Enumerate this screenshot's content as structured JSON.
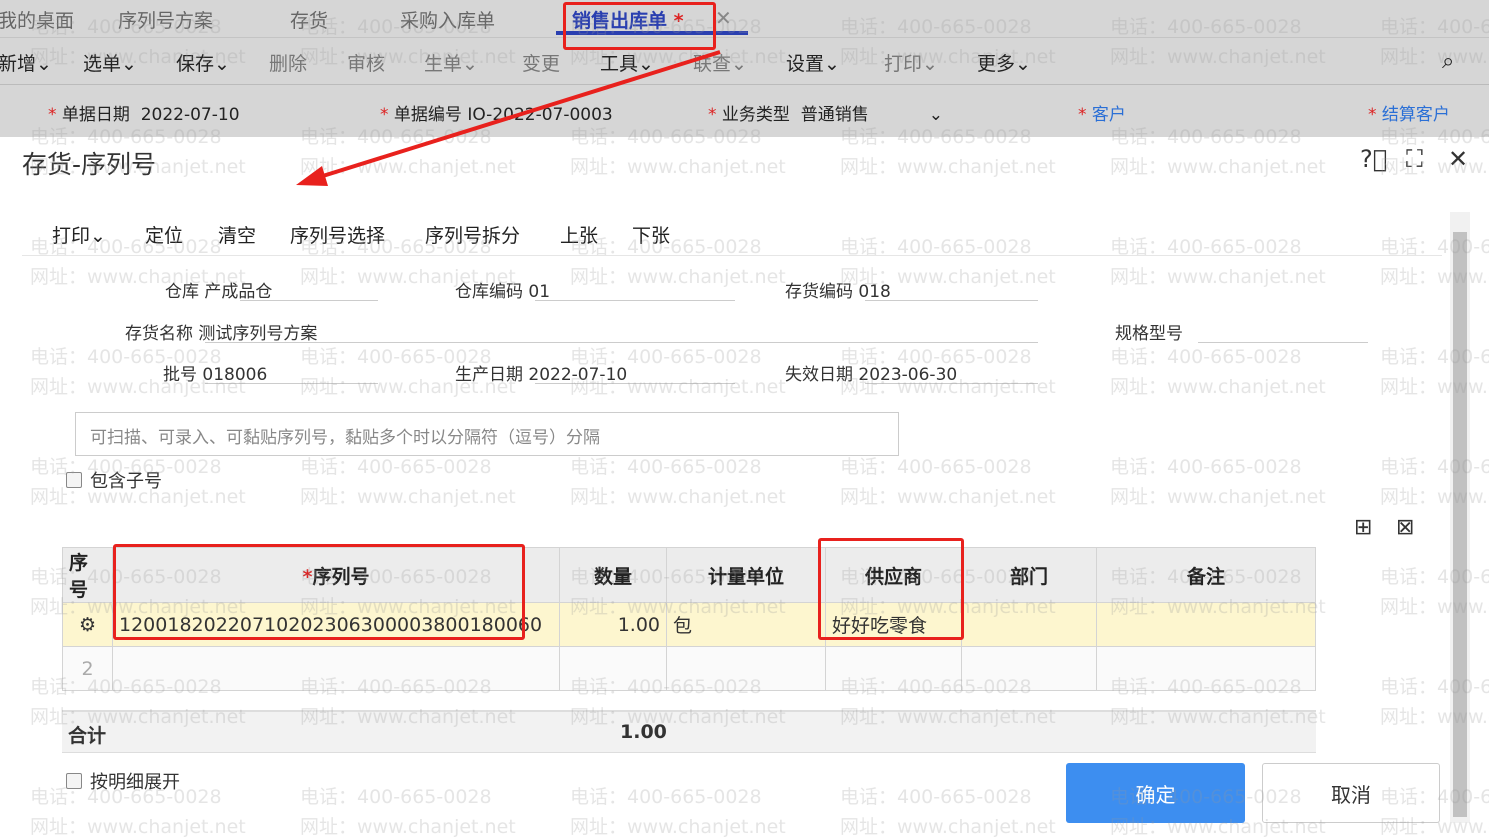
{
  "tabs": [
    "我的桌面",
    "序列号方案",
    "存货",
    "采购入库单",
    "销售出库单"
  ],
  "active_tab_star": "*",
  "toolbar": [
    "新增",
    "选单",
    "保存",
    "删除",
    "审核",
    "生单",
    "变更",
    "工具",
    "联查",
    "设置",
    "打印",
    "更多"
  ],
  "form": {
    "date_label": "单据日期",
    "date": "2022-07-10",
    "no_label": "单据编号",
    "no": "IO-2022-07-0003",
    "type_label": "业务类型",
    "type": "普通销售",
    "customer": "客户",
    "settle_customer": "结算客户"
  },
  "modal": {
    "title": "存货-序列号",
    "toolbar": [
      "打印",
      "定位",
      "清空",
      "序列号选择",
      "序列号拆分",
      "上张",
      "下张"
    ],
    "warehouse_label": "仓库",
    "warehouse": "产成品仓",
    "warehouse_code_label": "仓库编码",
    "warehouse_code": "01",
    "item_code_label": "存货编码",
    "item_code": "018",
    "item_name_label": "存货名称",
    "item_name": "测试序列号方案",
    "spec_label": "规格型号",
    "batch_label": "批号",
    "batch": "018006",
    "prod_date_label": "生产日期",
    "prod_date": "2022-07-10",
    "exp_date_label": "失效日期",
    "exp_date": "2023-06-30",
    "input_placeholder": "可扫描、可录入、可黏贴序列号，黏贴多个时以分隔符（逗号）分隔",
    "include_sub": "包含子号",
    "columns": [
      "序号",
      "序列号",
      "数量",
      "计量单位",
      "供应商",
      "部门",
      "备注"
    ],
    "rows": [
      {
        "serial": "120018202207102023063000038001800 60",
        "qty": "1.00",
        "unit": "包",
        "supplier": "好好吃零食"
      }
    ],
    "row2_no": "2",
    "total_label": "合计",
    "total_qty": "1.00",
    "expand_detail": "按明细展开",
    "ok": "确定",
    "cancel": "取消"
  },
  "watermark": {
    "phone": "电话：400-665-0028",
    "site": "网址：www.chanjet.net"
  },
  "colors": {
    "accent": "#3d8ef0",
    "annotation": "#e8211d",
    "tab_active": "#2a3fb0"
  }
}
